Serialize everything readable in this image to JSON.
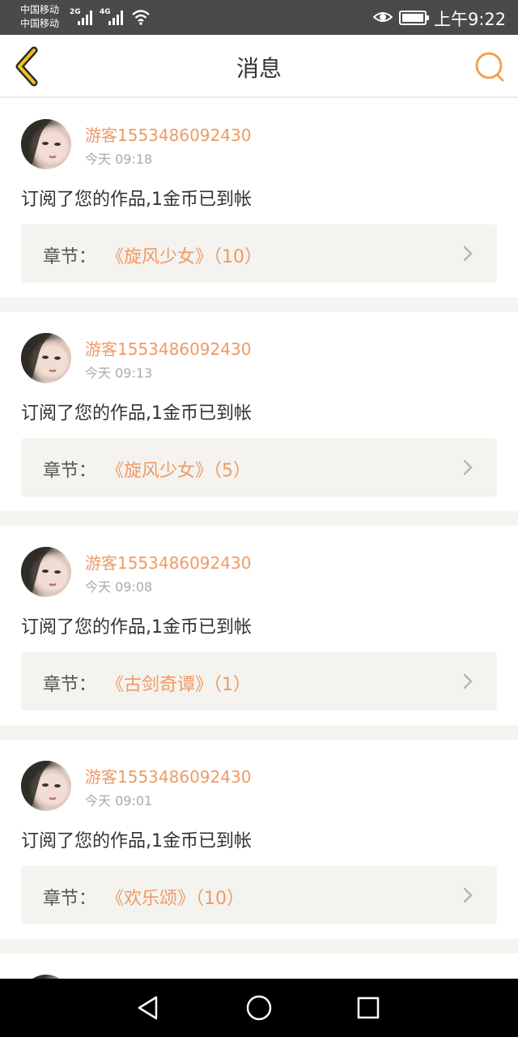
{
  "status_bar": {
    "carrier_1": "中国移动",
    "carrier_2": "中国移动",
    "network_1": "2G",
    "network_2": "4G",
    "time": "上午9:22"
  },
  "header": {
    "title": "消息",
    "back_icon": "chevron-left-icon",
    "search_icon": "search-icon",
    "accent_color": "#f2a14f"
  },
  "messages": [
    {
      "sender": "游客1553486092430",
      "time": "今天 09:18",
      "text": "订阅了您的作品,1金币已到帐",
      "chapter_label": "章节：",
      "chapter_value": "《旋风少女》（10）"
    },
    {
      "sender": "游客1553486092430",
      "time": "今天 09:13",
      "text": "订阅了您的作品,1金币已到帐",
      "chapter_label": "章节：",
      "chapter_value": "《旋风少女》（5）"
    },
    {
      "sender": "游客1553486092430",
      "time": "今天 09:08",
      "text": "订阅了您的作品,1金币已到帐",
      "chapter_label": "章节：",
      "chapter_value": "《古剑奇谭》（1）"
    },
    {
      "sender": "游客1553486092430",
      "time": "今天 09:01",
      "text": "订阅了您的作品,1金币已到帐",
      "chapter_label": "章节：",
      "chapter_value": "《欢乐颂》（10）"
    }
  ],
  "system_nav": {
    "back": "triangle-back-icon",
    "home": "circle-home-icon",
    "recents": "square-recents-icon"
  },
  "colors": {
    "name_accent": "#ef9a63",
    "chapter_bg": "#f4f3ef",
    "page_bg": "#f5f4f1"
  }
}
